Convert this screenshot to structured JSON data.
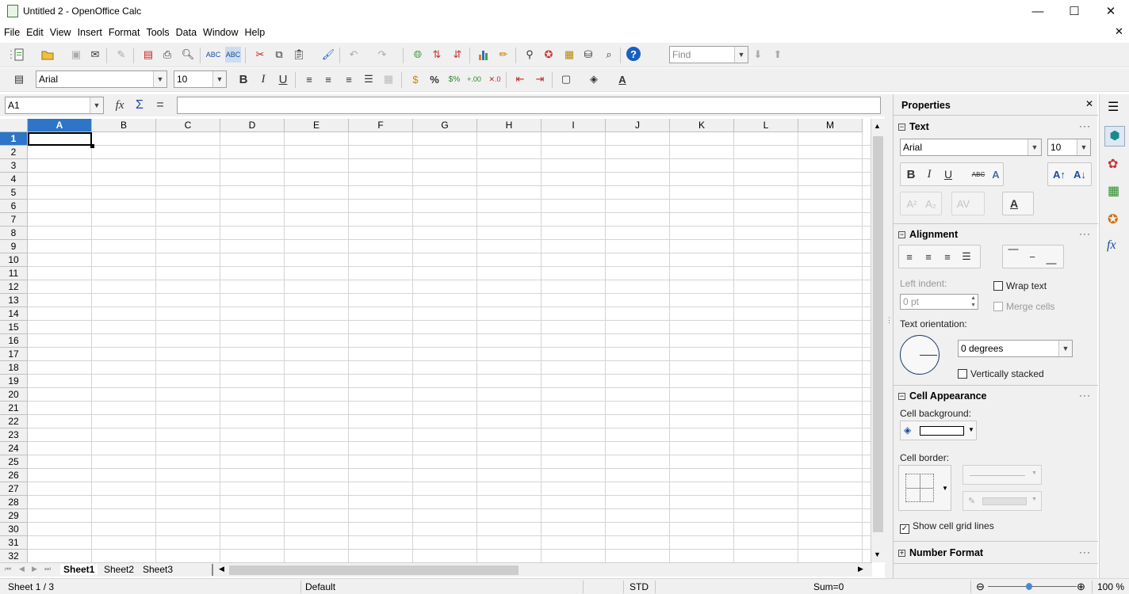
{
  "window": {
    "title": "Untitled 2 - OpenOffice Calc",
    "minimize_glyph": "—",
    "maximize_glyph": "☐",
    "close_glyph": "✕"
  },
  "menu": [
    "File",
    "Edit",
    "View",
    "Insert",
    "Format",
    "Tools",
    "Data",
    "Window",
    "Help"
  ],
  "menu_close_glyph": "✕",
  "standard_toolbar": {
    "find_placeholder": "Find"
  },
  "formatting_toolbar": {
    "font_name": "Arial",
    "font_size": "10",
    "bold": "B",
    "italic": "I",
    "underline": "U",
    "percent": "%"
  },
  "formula_bar": {
    "name_box": "A1",
    "fx": "fx",
    "sum": "Σ",
    "equals": "=",
    "input_value": ""
  },
  "sheet": {
    "columns": [
      "A",
      "B",
      "C",
      "D",
      "E",
      "F",
      "G",
      "H",
      "I",
      "J",
      "K",
      "L",
      "M"
    ],
    "rows": [
      "1",
      "2",
      "3",
      "4",
      "5",
      "6",
      "7",
      "8",
      "9",
      "10",
      "11",
      "12",
      "13",
      "14",
      "15",
      "16",
      "17",
      "18",
      "19",
      "20",
      "21",
      "22",
      "23",
      "24",
      "25",
      "26",
      "27",
      "28",
      "29",
      "30",
      "31",
      "32"
    ],
    "active_cell": "A1"
  },
  "tabs": {
    "sheets": [
      "Sheet1",
      "Sheet2",
      "Sheet3"
    ],
    "active": "Sheet1"
  },
  "status": {
    "sheet_pos": "Sheet 1 / 3",
    "page_style": "Default",
    "mode": "STD",
    "sum": "Sum=0",
    "zoom": "100 %",
    "zoom_level_percent": 100
  },
  "sidebar": {
    "title": "Properties",
    "text_section": {
      "title": "Text",
      "font_name": "Arial",
      "font_size": "10"
    },
    "alignment_section": {
      "title": "Alignment",
      "left_indent_label": "Left indent:",
      "left_indent_value": "0 pt",
      "wrap_text": "Wrap text",
      "merge_cells": "Merge cells",
      "text_orientation_label": "Text orientation:",
      "orientation_value": "0 degrees",
      "vertically_stacked": "Vertically stacked"
    },
    "cell_appearance_section": {
      "title": "Cell Appearance",
      "cell_background_label": "Cell background:",
      "cell_border_label": "Cell border:",
      "show_grid_lines": "Show cell grid lines",
      "show_grid_checked": "✓"
    },
    "number_format_section": {
      "title": "Number Format"
    }
  },
  "icons": {
    "accent": "#1a73c8",
    "selection_header": "#2e75c8"
  }
}
